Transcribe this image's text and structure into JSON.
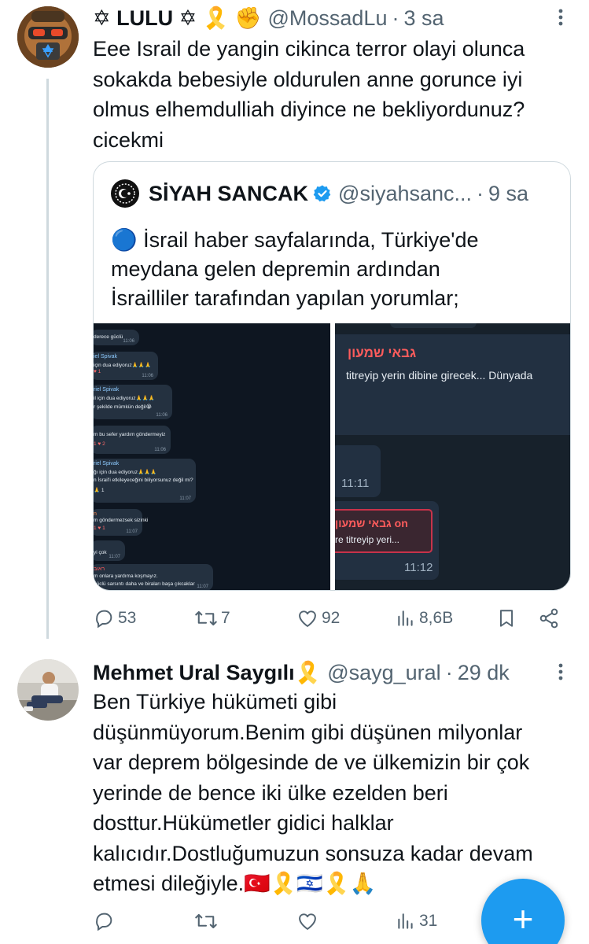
{
  "colors": {
    "accent": "#1d9bf0",
    "text": "#0f1419",
    "muted": "#536471",
    "border": "#cfd9de"
  },
  "tweet1": {
    "name": "✡ LULU ✡ 🎗️ ✊",
    "handle": "@MossadLu",
    "time": "3 sa",
    "lines": [
      "Eee  Israil de yangin cikinca terror olayi olunca",
      "sokakda bebesiyle oldurulen anne gorunce iyi",
      "olmus elhemdulliah diyince ne bekliyordunuz?",
      "cicekmi"
    ],
    "quote": {
      "name": "SİYAH SANCAK",
      "handle": "@siyahsanc...",
      "time": "9 sa",
      "lines": [
        "🔵 İsrail haber sayfalarında, Türkiye'de",
        "meydana gelen depremin ardından",
        "İsrailliler tarafından yapılan yorumlar;"
      ],
      "media_left": {
        "messages": [
          {
            "name": "",
            "text": "derece güclü",
            "time": "11:06"
          },
          {
            "name": "iel Spivak",
            "text": "için dua ediyoruz🙏🙏🙏",
            "time": "11:06"
          },
          {
            "name": "riel Spivak",
            "text": "il için dua ediyoruz🙏🙏🙏",
            "text2": "r şekilde mümkün değil😭",
            "time": "11:06"
          },
          {
            "name": "",
            "text": "m bu sefer yardım göndermeyiz",
            "time": "11:06"
          },
          {
            "name": "riel Spivak",
            "text": "ğı için dua ediyoruz🙏🙏🙏",
            "text2": "n İsrail'i etkileyeceğini biliyorsunuz değil mi?",
            "time": "11:07"
          },
          {
            "name": "n",
            "text": "m göndermezsek sizinki",
            "time": "11:07"
          },
          {
            "name": "",
            "text": "yi çok",
            "time": "11:07"
          },
          {
            "name": "ראוב",
            "text": "m onlara yardıma koşmayız.",
            "text2": "güclü sarsıntı daha ve biraları başa çıkcaklar",
            "time": "11:07"
          }
        ]
      },
      "media_right": {
        "top_name": "גבאי שמעון",
        "top_text": "titreyip yerin dibine girecek... Dünyada",
        "time1": "11:11",
        "bottom_name": "גבאי שמעון on",
        "bottom_text": "re titreyip yeri...",
        "time2": "11:12"
      }
    },
    "stats": {
      "replies": "53",
      "retweets": "7",
      "likes": "92",
      "views": "8,6B"
    }
  },
  "tweet2": {
    "name": "Mehmet Ural Saygılı🎗️",
    "handle": "@sayg_ural",
    "time": "29 dk",
    "lines": [
      "Ben Türkiye hükümeti gibi",
      "düşünmüyorum.Benim gibi düşünen milyonlar",
      "var deprem bölgesinde de ve ülkemizin bir çok",
      "yerinde de bence iki ülke ezelden beri",
      "dosttur.Hükümetler gidici halklar",
      "kalıcıdır.Dostluğumuzun sonsuza kadar devam",
      "etmesi dileğiyle.🇹🇷🎗️🇮🇱🎗️🙏"
    ],
    "stats": {
      "views": "31"
    }
  },
  "fab_label": "+"
}
